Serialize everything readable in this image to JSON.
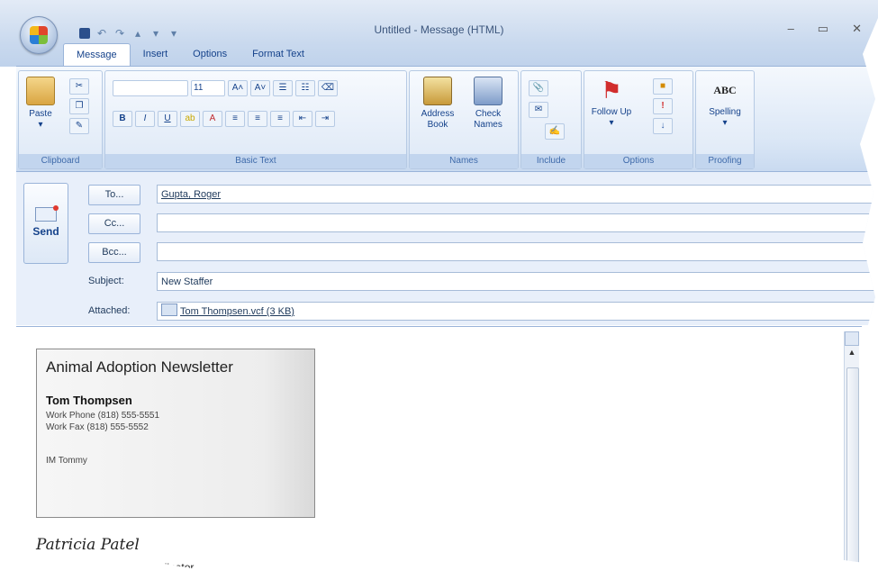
{
  "window": {
    "title": "Untitled - Message (HTML)"
  },
  "tabs": [
    {
      "label": "Message"
    },
    {
      "label": "Insert"
    },
    {
      "label": "Options"
    },
    {
      "label": "Format Text"
    }
  ],
  "ribbon": {
    "clipboard": {
      "paste": "Paste",
      "group": "Clipboard"
    },
    "basic_text": {
      "font_size": "11",
      "group": "Basic Text"
    },
    "names": {
      "address_book": "Address Book",
      "check_names": "Check Names",
      "group": "Names"
    },
    "include": {
      "group": "Include"
    },
    "options": {
      "follow_up": "Follow Up",
      "group": "Options"
    },
    "proofing": {
      "spelling_icon": "ABC",
      "spelling": "Spelling",
      "group": "Proofing"
    }
  },
  "header": {
    "send": "Send",
    "to_button": "To...",
    "cc_button": "Cc...",
    "bcc_button": "Bcc...",
    "to_value": "Gupta, Roger",
    "cc_value": "",
    "bcc_value": "",
    "subject_label": "Subject:",
    "subject_value": "New Staffer",
    "attached_label": "Attached:",
    "attached_file": "Tom Thompsen.vcf (3 KB)"
  },
  "body": {
    "card": {
      "title": "Animal Adoption Newsletter",
      "name": "Tom Thompsen",
      "work_phone": "Work Phone (818) 555-5551",
      "work_fax": "Work Fax (818) 555-5552",
      "im": "IM Tommy"
    },
    "signature": {
      "name": "Patricia Patel",
      "title": "Assistant Production Coordinator"
    }
  }
}
